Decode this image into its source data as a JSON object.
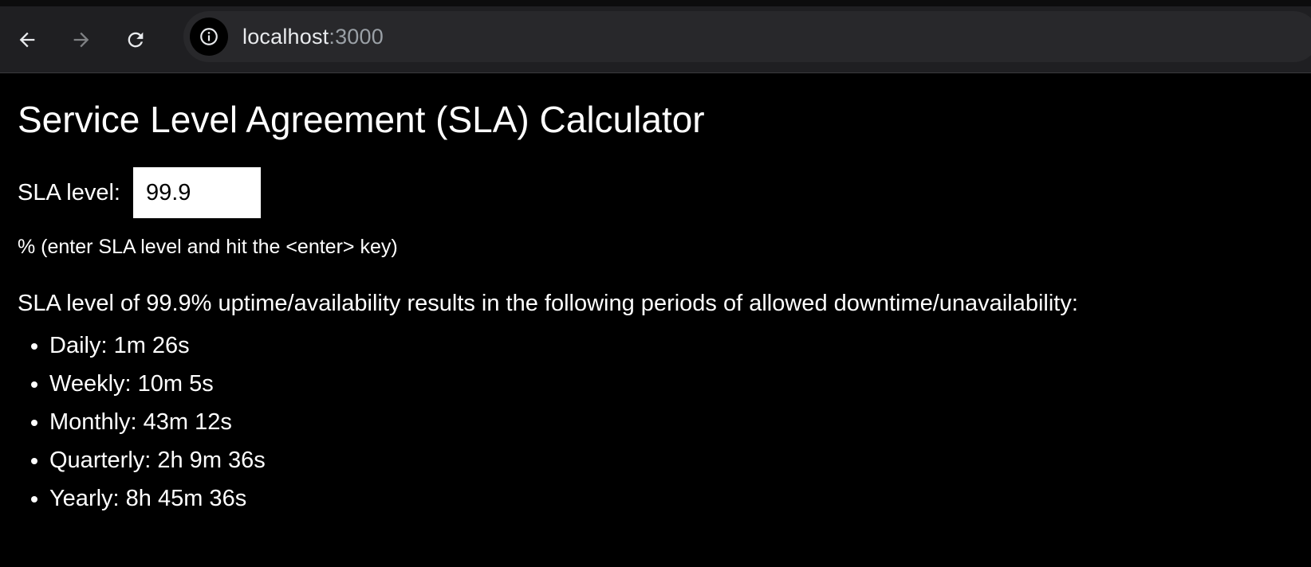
{
  "browser": {
    "url_host": "localhost",
    "url_port": ":3000",
    "icons": {
      "back": "back-arrow-icon",
      "forward": "forward-arrow-icon",
      "reload": "reload-icon",
      "info": "info-icon"
    }
  },
  "page": {
    "title": "Service Level Agreement (SLA) Calculator",
    "sla_label": "SLA level:",
    "sla_value": "99.9",
    "hint": "% (enter SLA level and hit the <enter> key)",
    "result_text": "SLA level of 99.9% uptime/availability results in the following periods of allowed downtime/unavailability:",
    "periods": [
      "Daily: 1m 26s",
      "Weekly: 10m 5s",
      "Monthly: 43m 12s",
      "Quarterly: 2h 9m 36s",
      "Yearly: 8h 45m 36s"
    ]
  },
  "colors": {
    "background": "#000000",
    "toolbar": "#1f1f22",
    "omnibox": "#28282b",
    "text": "#ffffff",
    "port_text": "#9aa0a6"
  }
}
